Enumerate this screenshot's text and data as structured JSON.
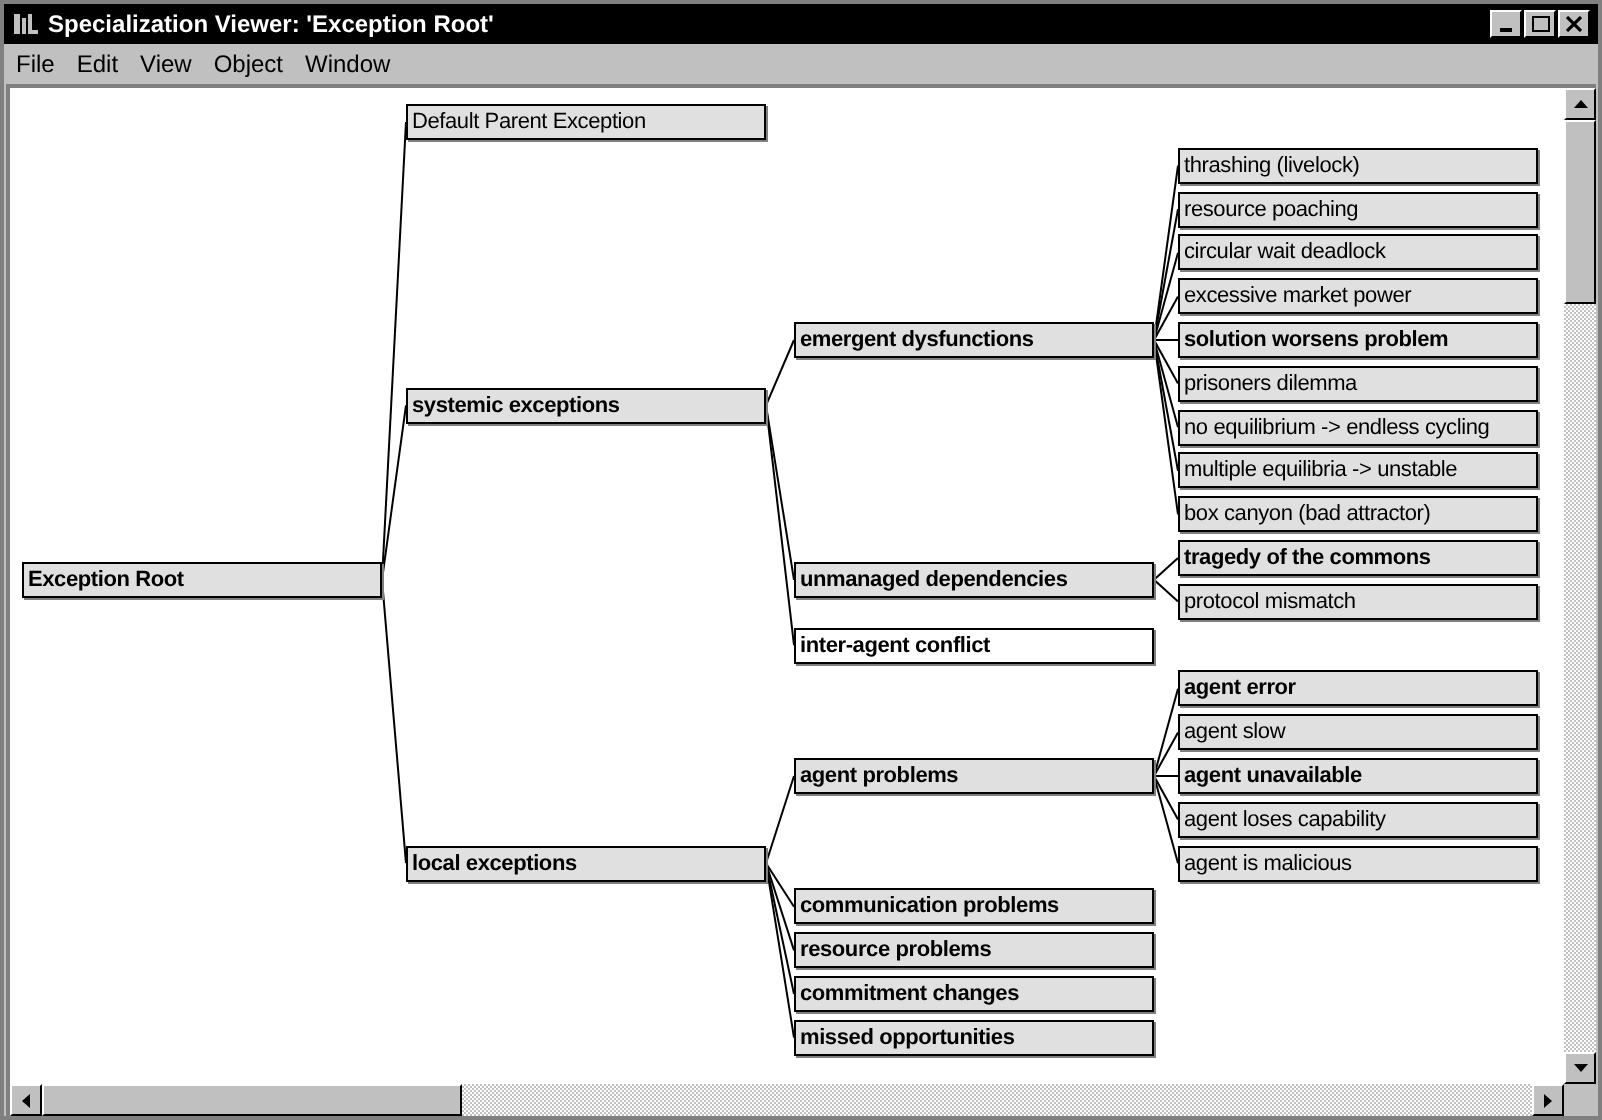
{
  "window": {
    "title": "Specialization Viewer: 'Exception Root'"
  },
  "menu": [
    "File",
    "Edit",
    "View",
    "Object",
    "Window"
  ],
  "tree": {
    "label": "Exception Root",
    "bold": true,
    "shaded": true,
    "children": [
      {
        "label": "Default Parent Exception",
        "bold": false,
        "shaded": true
      },
      {
        "label": "systemic exceptions",
        "bold": true,
        "shaded": true,
        "children": [
          {
            "label": "emergent dysfunctions",
            "bold": true,
            "shaded": true,
            "children": [
              {
                "label": "thrashing (livelock)",
                "bold": false,
                "shaded": true
              },
              {
                "label": "resource poaching",
                "bold": false,
                "shaded": true
              },
              {
                "label": "circular wait deadlock",
                "bold": false,
                "shaded": true
              },
              {
                "label": "excessive market power",
                "bold": false,
                "shaded": true
              },
              {
                "label": "solution worsens problem",
                "bold": true,
                "shaded": true
              },
              {
                "label": "prisoners dilemma",
                "bold": false,
                "shaded": true
              },
              {
                "label": "no equilibrium -> endless cycling",
                "bold": false,
                "shaded": true
              },
              {
                "label": "multiple equilibria -> unstable",
                "bold": false,
                "shaded": true
              },
              {
                "label": "box canyon (bad attractor)",
                "bold": false,
                "shaded": true
              }
            ]
          },
          {
            "label": "unmanaged dependencies",
            "bold": true,
            "shaded": true,
            "children": [
              {
                "label": "tragedy of the commons",
                "bold": true,
                "shaded": true
              },
              {
                "label": "protocol mismatch",
                "bold": false,
                "shaded": true
              }
            ]
          },
          {
            "label": "inter-agent conflict",
            "bold": true,
            "shaded": false
          }
        ]
      },
      {
        "label": "local exceptions",
        "bold": true,
        "shaded": true,
        "children": [
          {
            "label": "agent problems",
            "bold": true,
            "shaded": true,
            "children": [
              {
                "label": "agent error",
                "bold": true,
                "shaded": true
              },
              {
                "label": "agent slow",
                "bold": false,
                "shaded": true
              },
              {
                "label": "agent unavailable",
                "bold": true,
                "shaded": true
              },
              {
                "label": "agent loses capability",
                "bold": false,
                "shaded": true
              },
              {
                "label": "agent is malicious",
                "bold": false,
                "shaded": true
              }
            ]
          },
          {
            "label": "communication problems",
            "bold": true,
            "shaded": true
          },
          {
            "label": "resource problems",
            "bold": true,
            "shaded": true
          },
          {
            "label": "commitment changes",
            "bold": true,
            "shaded": true
          },
          {
            "label": "missed opportunities",
            "bold": true,
            "shaded": true
          }
        ]
      }
    ]
  }
}
